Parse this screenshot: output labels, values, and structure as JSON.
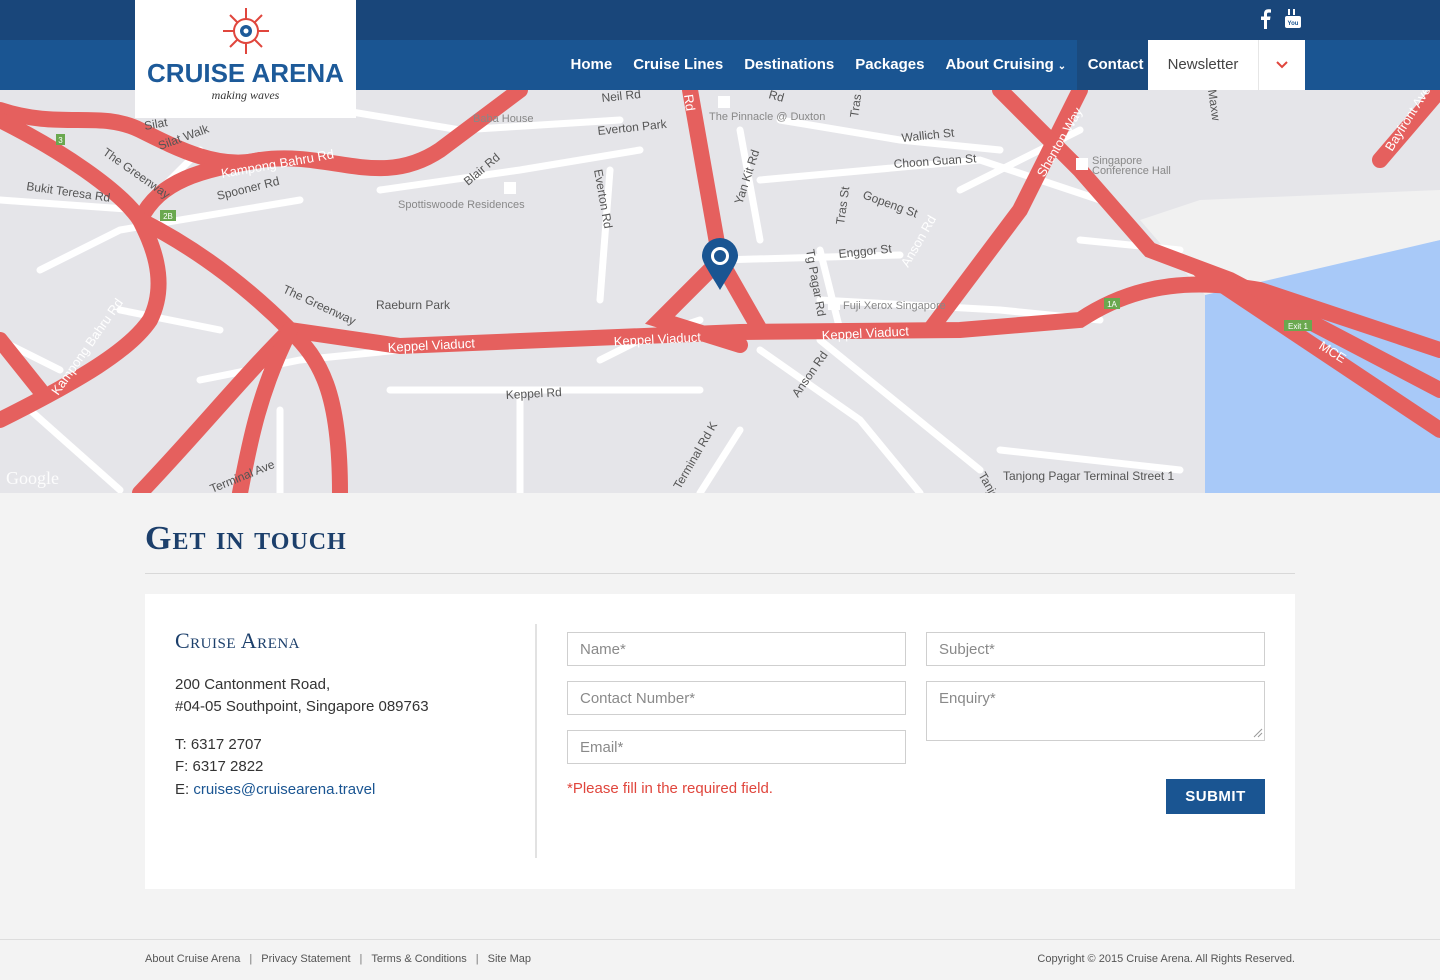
{
  "brand": {
    "name": "CRUISE ARENA",
    "tagline": "making waves",
    "colors": {
      "primary": "#1a5592",
      "topbar": "#19467a",
      "accent": "#e0463d",
      "road": "#e5605e"
    }
  },
  "social": [
    {
      "icon": "facebook-icon"
    },
    {
      "icon": "youtube-icon"
    }
  ],
  "nav": {
    "items": [
      {
        "label": "Home"
      },
      {
        "label": "Cruise Lines"
      },
      {
        "label": "Destinations"
      },
      {
        "label": "Packages"
      },
      {
        "label": "About Cruising",
        "has_dropdown": true
      },
      {
        "label": "Contact Us",
        "active": true
      }
    ],
    "newsletter_label": "Newsletter",
    "toggle_icon": "chevron-down-icon"
  },
  "map": {
    "watermark": "Google",
    "marker_icon": "location-pin-icon",
    "labels": {
      "neil_rd": "Neil Rd",
      "everton_park": "Everton Park",
      "the_pinnacle": "The Pinnacle @ Duxton",
      "wallich_st": "Wallich St",
      "choon_guan_st": "Choon Guan St",
      "singapore_conference_hall_1": "Singapore",
      "singapore_conference_hall_2": "Conference Hall",
      "shenton_way": "Shenton Way",
      "bayfront_ave": "Bayfront Ave",
      "silat_walk": "Silat Walk",
      "silat": "Silat",
      "the_greenway": "The Greenway",
      "kampong_bahru_rd": "Kampong Bahru Rd",
      "spooner_rd": "Spooner Rd",
      "bukit_teresa_rd": "Bukit Teresa Rd",
      "blair_rd": "Blair Rd",
      "everton_rd": "Everton Rd",
      "spottiswoode": "Spottiswoode Residences",
      "yan_kit_rd": "Yan Kit Rd",
      "tras_st": "Tras St",
      "gopeng_st": "Gopeng St",
      "enggor_st": "Enggor St",
      "anson_rd": "Anson Rd",
      "tg_pagar_rd": "Tg Pagar Rd",
      "fuji_xerox": "Fuji Xerox Singapore",
      "raeburn_park": "Raeburn Park",
      "the_greenway_2": "The Greenway",
      "keppel_viaduct_1": "Keppel Viaduct",
      "keppel_viaduct_2": "Keppel Viaduct",
      "keppel_viaduct_3": "Keppel Viaduct",
      "kampong_bahru_rd_2": "Kampong Bahru Rd",
      "keppel_rd": "Keppel Rd",
      "anson_rd_2": "Anson Rd",
      "terminal_rd_k": "Terminal Rd K",
      "terminal_ave": "Terminal Ave",
      "tanjong_pagar_terminal": "Tanjong Pagar Terminal Street 1",
      "mcf": "MCE",
      "exit_1": "Exit 1",
      "badge_3": "3",
      "badge_2b": "2B",
      "badge_1a": "1A",
      "bababouse": "Baba House",
      "rd_top": "Rd",
      "rd_top2": "Rd",
      "maxw": "Maxw",
      "tras_top": "Tras S",
      "tanjo": "Tanjo"
    }
  },
  "contact": {
    "heading": "Get in touch",
    "company": "Cruise Arena",
    "address_line1": "200 Cantonment Road,",
    "address_line2": "#04-05 Southpoint, Singapore 089763",
    "phone": "T: 6317 2707",
    "fax": "F: 6317 2822",
    "email_prefix": "E: ",
    "email": "cruises@cruisearena.travel"
  },
  "form": {
    "name_placeholder": "Name*",
    "contact_placeholder": "Contact Number*",
    "email_placeholder": "Email*",
    "subject_placeholder": "Subject*",
    "enquiry_placeholder": "Enquiry*",
    "required_note": "*Please fill in the required field.",
    "submit_label": "SUBMIT"
  },
  "footer": {
    "links": [
      {
        "label": "About Cruise Arena"
      },
      {
        "label": "Privacy Statement"
      },
      {
        "label": "Terms & Conditions"
      },
      {
        "label": "Site Map"
      }
    ],
    "separator": "|",
    "copyright": "Copyright © 2015 Cruise Arena. All Rights Reserved."
  }
}
